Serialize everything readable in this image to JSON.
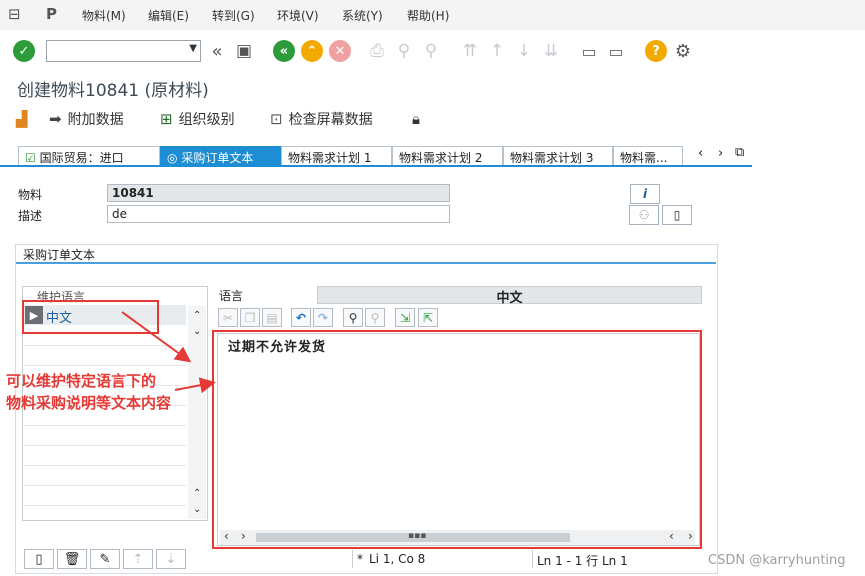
{
  "menu": {
    "items": [
      "物料(M)",
      "编辑(E)",
      "转到(G)",
      "环境(V)",
      "系统(Y)",
      "帮助(H)"
    ]
  },
  "toolbar": {
    "command_field_value": "",
    "icons": [
      "check-icon",
      "back-double-icon",
      "save-icon",
      "back-icon",
      "exit-icon",
      "cancel-icon",
      "print-icon",
      "find-icon",
      "find-next-icon",
      "first-page-icon",
      "prev-page-icon",
      "next-page-icon",
      "last-page-icon",
      "create-session-icon",
      "shortcut-icon",
      "help-icon",
      "settings-icon"
    ]
  },
  "page": {
    "title": "创建物料10841 (原材料)"
  },
  "app_toolbar": {
    "additional_data": "附加数据",
    "org_levels": "组织级别",
    "check_screen_data": "检查屏幕数据"
  },
  "tabs": [
    {
      "label": "国际贸易：进口",
      "active": false
    },
    {
      "label": "采购订单文本",
      "active": true
    },
    {
      "label": "物料需求计划 1",
      "active": false
    },
    {
      "label": "物料需求计划 2",
      "active": false
    },
    {
      "label": "物料需求计划 3",
      "active": false
    },
    {
      "label": "物料需...",
      "active": false
    }
  ],
  "header": {
    "material_label": "物料",
    "material_value": "10841",
    "description_label": "描述",
    "description_value": "de"
  },
  "group": {
    "title": "采购订单文本",
    "maintain_lang_header": "维护语言",
    "languages": [
      "中文"
    ],
    "lang_label": "语言",
    "lang_value": "中文"
  },
  "editor": {
    "text": "过期不允许发货"
  },
  "annotation": {
    "line1": "可以维护特定语言下的",
    "line2": "物料采购说明等文本内容"
  },
  "status": {
    "star": "*",
    "position": "Li 1, Co 8",
    "lines": "Ln 1 - 1 行 Ln 1"
  },
  "watermark": "CSDN @karryhunting",
  "colors": {
    "accent": "#1e8ed4",
    "annotation_red": "#e53935",
    "check_green": "#2e9b3a",
    "nav_yellow": "#f2a900"
  }
}
